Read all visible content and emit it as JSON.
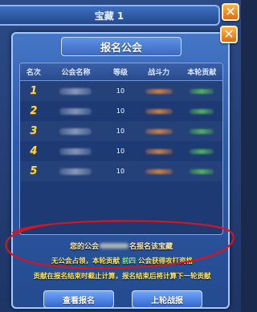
{
  "back_window": {
    "title": "宝藏 1",
    "close_glyph": "✕"
  },
  "dialog": {
    "title": "报名公会",
    "close_glyph": "✕",
    "columns": [
      "名次",
      "公会名称",
      "等级",
      "战斗力",
      "本轮贡献"
    ],
    "rows": [
      {
        "rank": "1",
        "level": "10"
      },
      {
        "rank": "2",
        "level": "10"
      },
      {
        "rank": "3",
        "level": "10"
      },
      {
        "rank": "4",
        "level": "10"
      },
      {
        "rank": "5",
        "level": "10"
      }
    ],
    "status_prefix": "您的公会",
    "status_suffix": "名报名该宝藏",
    "notice_line1_a": "无公会占领，本轮贡献",
    "notice_line1_highlight": "前四",
    "notice_line1_b": "公会获得攻打资格",
    "notice_line2": "贡献在报名结束时截止计算，报名结束后将计算下一轮贡献",
    "button_left": "查看报名",
    "button_right": "上轮战报"
  },
  "colors": {
    "rank_gold": "#ffd84a",
    "notice_yellow": "#ffea6a",
    "highlight_green": "#8cff6a",
    "annotation_red": "#d8141c"
  }
}
